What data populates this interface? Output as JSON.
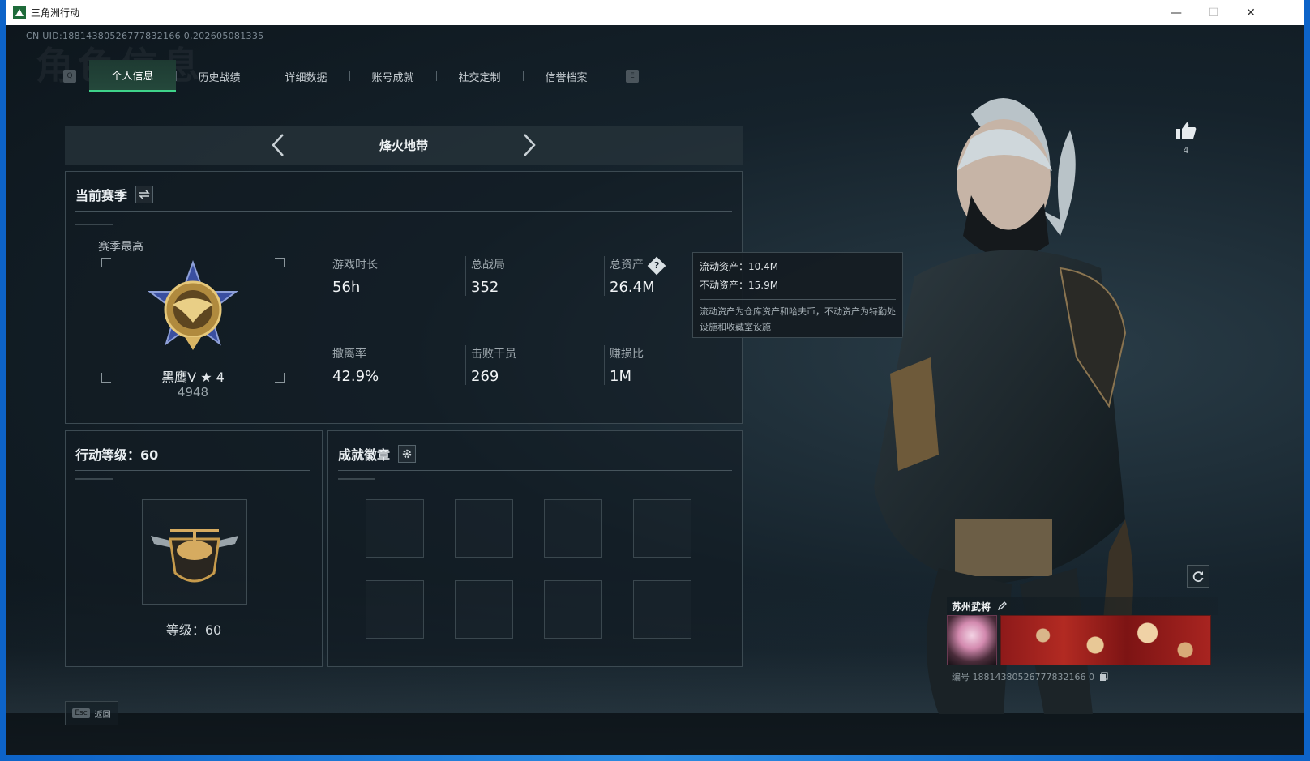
{
  "window": {
    "title": "三角洲行动",
    "minimize": "—",
    "maximize": "☐",
    "close": "✕"
  },
  "header": {
    "uid": "CN UID:18814380526777832166 0,202605081335",
    "bg_title": "角色信息"
  },
  "tabs": {
    "left_key": "Q",
    "right_key": "E",
    "items": [
      {
        "label": "个人信息",
        "active": true
      },
      {
        "label": "历史战绩"
      },
      {
        "label": "详细数据"
      },
      {
        "label": "账号成就"
      },
      {
        "label": "社交定制"
      },
      {
        "label": "信誉档案"
      }
    ]
  },
  "mode": {
    "title": "烽火地带"
  },
  "season": {
    "title": "当前赛季",
    "best_label": "赛季最高",
    "rank_name": "黑鹰V ★ 4",
    "rank_score": "4948",
    "stats": [
      {
        "label": "游戏时长",
        "value": "56h"
      },
      {
        "label": "总战局",
        "value": "352"
      },
      {
        "label": "总资产",
        "value": "26.4M"
      },
      {
        "label": "撤离率",
        "value": "42.9%"
      },
      {
        "label": "击败干员",
        "value": "269"
      },
      {
        "label": "赚损比",
        "value": "1M"
      }
    ]
  },
  "tooltip": {
    "liquid": "流动资产：10.4M",
    "fixed": "不动资产：15.9M",
    "note": "流动资产为仓库资产和哈夫币，不动资产为特勤处设施和收藏室设施"
  },
  "level": {
    "title": "行动等级：60",
    "label": "等级：60"
  },
  "badges": {
    "title": "成就徽章"
  },
  "profile": {
    "likes": "4",
    "name": "苏州武将",
    "id_text": "编号 18814380526777832166 0"
  },
  "footer": {
    "esc_key": "Esc",
    "esc_label": "返回"
  },
  "colors": {
    "accent_green": "#3fd38a",
    "panel_border": "#3c4a52",
    "bg": "#0e171e"
  }
}
